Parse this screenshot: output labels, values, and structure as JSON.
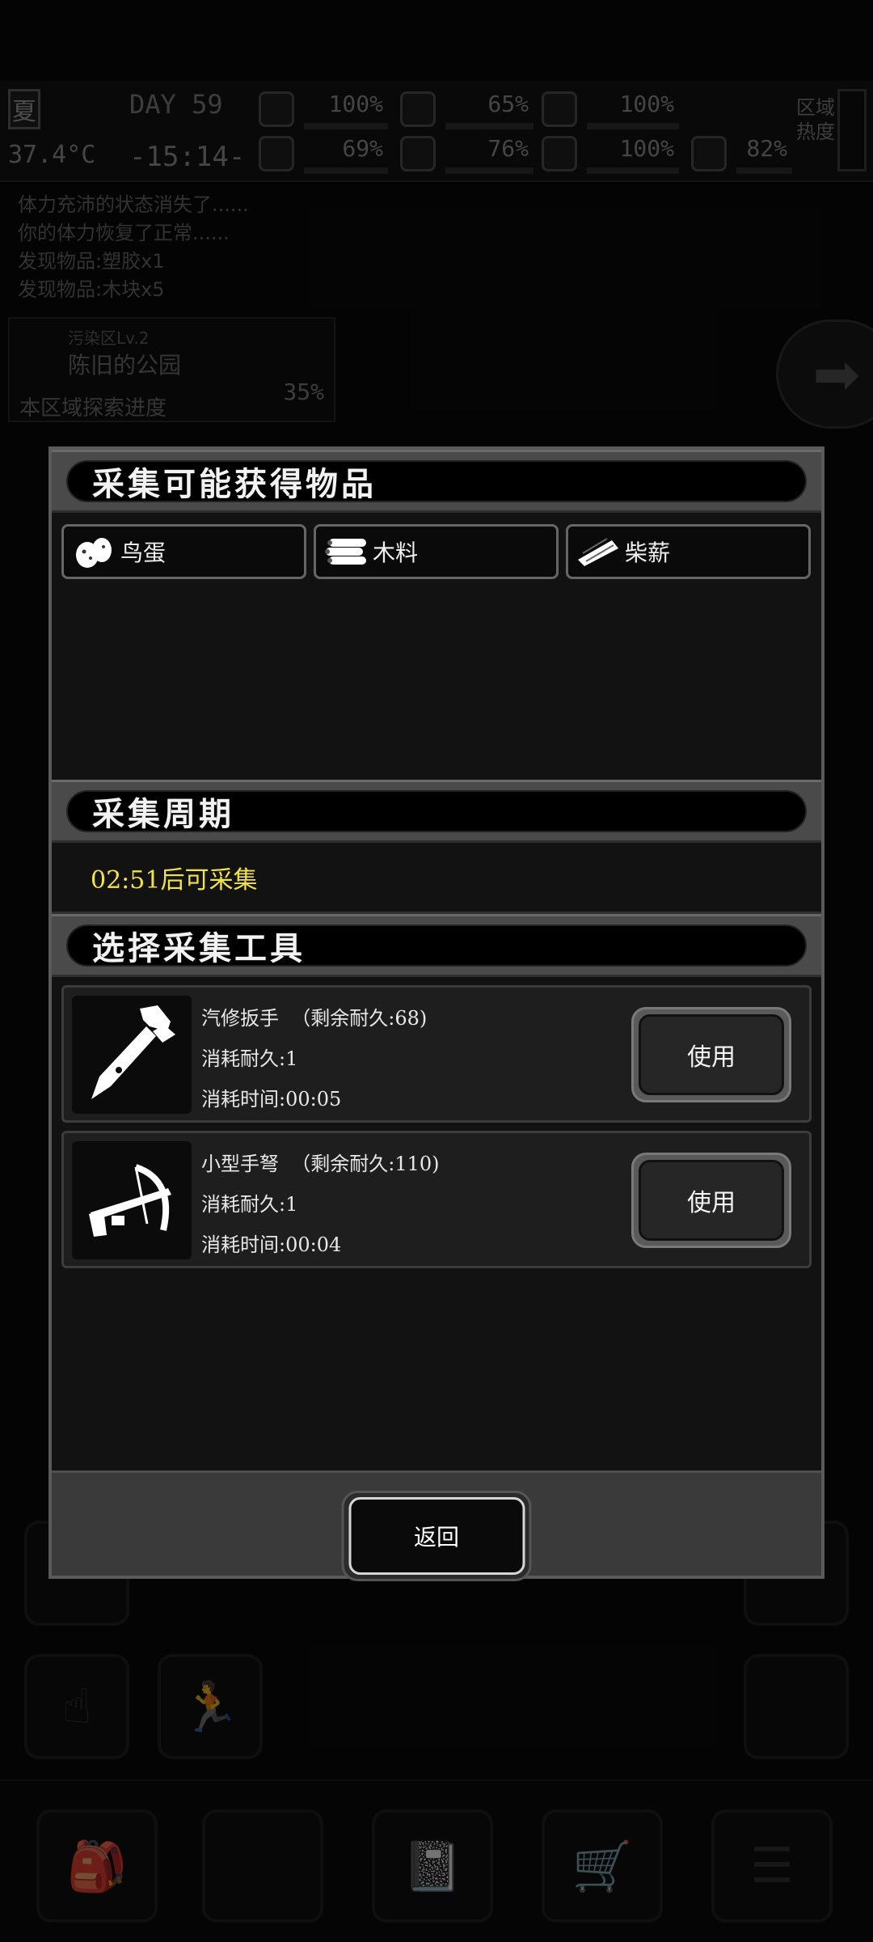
{
  "hud": {
    "season": "夏",
    "temperature": "37.4°C",
    "day_label": "DAY",
    "day_number": "59",
    "clock": "-15:14-",
    "stats": [
      {
        "pct": "100%",
        "icon": "medkit-icon",
        "level": 1.0
      },
      {
        "pct": "65%",
        "icon": "stomach-icon",
        "level": 0.65
      },
      {
        "pct": "100%",
        "icon": "armor-icon",
        "level": 1.0
      },
      {
        "pct": "69%",
        "icon": "brain-icon",
        "level": 0.69
      },
      {
        "pct": "76%",
        "icon": "water-drop-icon",
        "level": 0.76
      },
      {
        "pct": "100%",
        "icon": "heart-icon",
        "level": 1.0
      },
      {
        "pct": "82%",
        "icon": "volume-icon",
        "level": 0.82
      }
    ],
    "area_heat_label": "区域热度"
  },
  "log": [
    "体力充沛的状态消失了......",
    "你的体力恢复了正常......",
    "发现物品:塑胶x1",
    "发现物品:木块x5"
  ],
  "area": {
    "level": "污染区Lv.2",
    "name": "陈旧的公园",
    "progress_label": "本区域探索进度",
    "progress_pct": "35%",
    "progress": 0.35
  },
  "modal": {
    "items_header": "采集可能获得物品",
    "items": [
      {
        "name": "鸟蛋",
        "icon": "egg-icon"
      },
      {
        "name": "木料",
        "icon": "logs-icon"
      },
      {
        "name": "柴薪",
        "icon": "firewood-icon"
      }
    ],
    "cycle_header": "采集周期",
    "cycle_text": "02:51后可采集",
    "tools_header": "选择采集工具",
    "tools": [
      {
        "name": "汽修扳手",
        "durability": "（剩余耐久:68)",
        "cost": "消耗耐久:1",
        "time": "消耗时间:00:05",
        "icon": "wrench-axe-icon",
        "button": "使用"
      },
      {
        "name": "小型手弩",
        "durability": "（剩余耐久:110)",
        "cost": "消耗耐久:1",
        "time": "消耗时间:00:04",
        "icon": "crossbow-icon",
        "button": "使用"
      }
    ],
    "back_button": "返回"
  }
}
